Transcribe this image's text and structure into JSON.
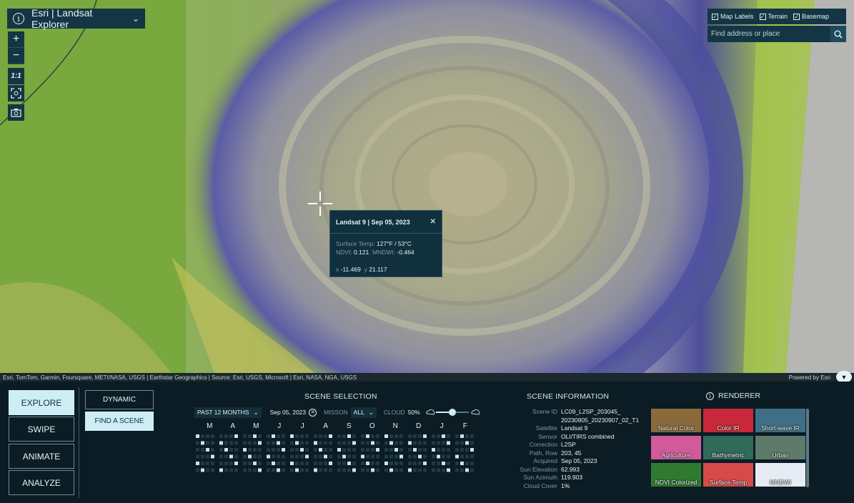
{
  "app": {
    "title": "Esri | Landsat Explorer"
  },
  "map": {
    "layers": [
      {
        "label": "Map Labels",
        "checked": true
      },
      {
        "label": "Terrain",
        "checked": true
      },
      {
        "label": "Basemap",
        "checked": true
      }
    ],
    "search_placeholder": "Find address or place",
    "zoom_in": "+",
    "zoom_out": "−",
    "scale_label": "1:1",
    "attribution": "Esri, TomTom, Garmin, Foursquare, METI/NASA, USGS | Earthstar Geographics | Source: Esri, USGS, Microsoft | Esri, NASA, NGA, USGS",
    "powered_by": "Powered by Esri"
  },
  "popup": {
    "title": "Landsat 9 | Sep 05, 2023",
    "surface_temp_label": "Surface Temp:",
    "surface_temp_value": "127°F / 53°C",
    "ndvi_label": "NDVI:",
    "ndvi_value": "0.121",
    "mndwi_label": "MNDWI:",
    "mndwi_value": "-0.464",
    "x_label": "x",
    "x_value": "-11.469",
    "y_label": "y",
    "y_value": "21.117"
  },
  "modes": [
    "EXPLORE",
    "SWIPE",
    "ANIMATE",
    "ANALYZE"
  ],
  "submodes": [
    "DYNAMIC",
    "FIND A SCENE"
  ],
  "scene_selection": {
    "title": "SCENE SELECTION",
    "period": "PAST 12 MONTHS",
    "date": "Sep 05, 2023",
    "mission_label": "MISSON",
    "mission_value": "ALL",
    "cloud_label": "CLOUD",
    "cloud_value": "50%",
    "cloud_fraction": 0.5,
    "months": [
      "M",
      "A",
      "M",
      "J",
      "J",
      "A",
      "S",
      "O",
      "N",
      "D",
      "J",
      "F"
    ]
  },
  "scene_info": {
    "title": "SCENE INFORMATION",
    "rows": [
      {
        "k": "Scene ID",
        "v": "LC09_L2SP_203045_"
      },
      {
        "k": "",
        "v": "20230905_20230907_02_T1"
      },
      {
        "k": "Satellite",
        "v": "Landsat 9"
      },
      {
        "k": "Sensor",
        "v": "OLI/TIRS combined"
      },
      {
        "k": "Correction",
        "v": "L2SP"
      },
      {
        "k": "Path, Row",
        "v": "203, 45"
      },
      {
        "k": "Acquired",
        "v": "Sep 05, 2023"
      },
      {
        "k": "Sun Elevation",
        "v": "62.993"
      },
      {
        "k": "Sun Azimuth",
        "v": "119.903"
      },
      {
        "k": "Cloud Cover",
        "v": "1%"
      }
    ]
  },
  "renderer": {
    "title": "RENDERER",
    "items": [
      {
        "label": "Natural Color",
        "color": "#8a6a3a"
      },
      {
        "label": "Color IR",
        "color": "#c8283a"
      },
      {
        "label": "Short-wave IR",
        "color": "#3f6f86"
      },
      {
        "label": "Agriculture",
        "color": "#d05a9a"
      },
      {
        "label": "Bathymetric",
        "color": "#2f6a5a"
      },
      {
        "label": "Urban",
        "color": "#5e7a6a"
      },
      {
        "label": "NDVI Colorized",
        "color": "#2f7a30"
      },
      {
        "label": "Surface Temp",
        "color": "#d84a4a"
      },
      {
        "label": "MNDWI",
        "color": "#e6ecf4"
      }
    ]
  }
}
